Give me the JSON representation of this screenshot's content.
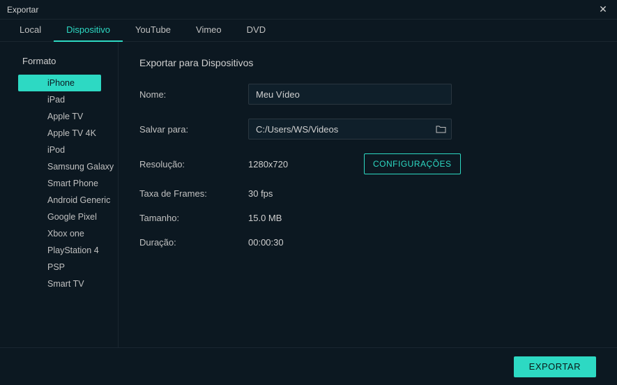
{
  "window": {
    "title": "Exportar"
  },
  "tabs": [
    {
      "label": "Local"
    },
    {
      "label": "Dispositivo"
    },
    {
      "label": "YouTube"
    },
    {
      "label": "Vimeo"
    },
    {
      "label": "DVD"
    }
  ],
  "sidebar": {
    "heading": "Formato",
    "items": [
      "iPhone",
      "iPad",
      "Apple TV",
      "Apple TV 4K",
      "iPod",
      "Samsung Galaxy",
      "Smart Phone",
      "Android Generic",
      "Google Pixel",
      "Xbox one",
      "PlayStation 4",
      "PSP",
      "Smart TV"
    ]
  },
  "main": {
    "title": "Exportar para Dispositivos",
    "name_label": "Nome:",
    "name_value": "Meu Vídeo",
    "save_label": "Salvar para:",
    "save_value": "C:/Users/WS/Videos",
    "resolution_label": "Resolução:",
    "resolution_value": "1280x720",
    "settings_btn": "CONFIGURAÇÕES",
    "framerate_label": "Taxa de Frames:",
    "framerate_value": "30 fps",
    "size_label": "Tamanho:",
    "size_value": "15.0 MB",
    "duration_label": "Duração:",
    "duration_value": "00:00:30"
  },
  "footer": {
    "export_btn": "EXPORTAR"
  }
}
